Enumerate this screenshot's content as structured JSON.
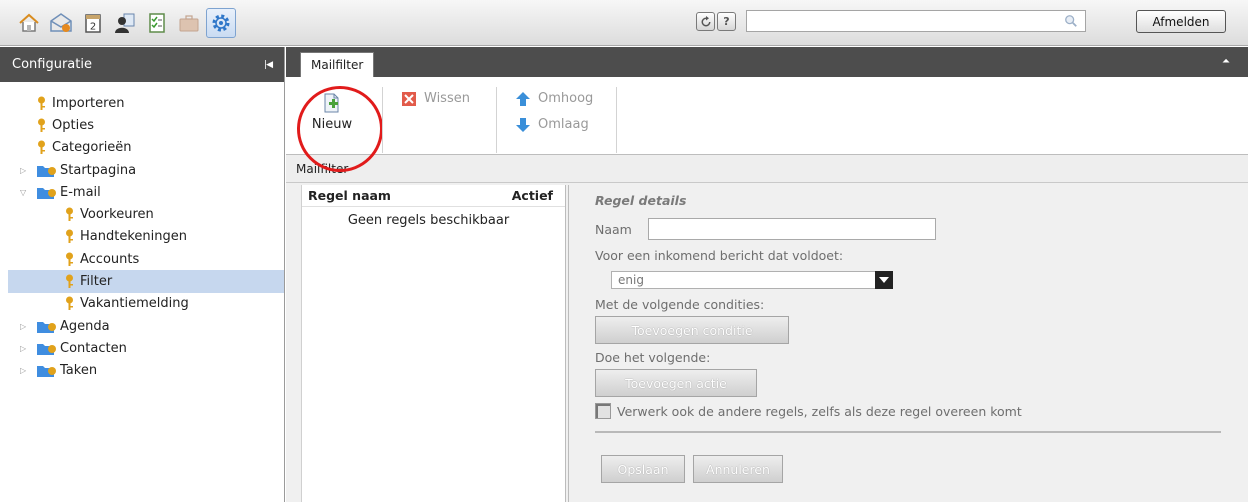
{
  "topbar": {
    "apps": [
      {
        "icon": "home-icon"
      },
      {
        "icon": "mail-icon"
      },
      {
        "icon": "calendar-icon",
        "text": "2"
      },
      {
        "icon": "contacts-icon"
      },
      {
        "icon": "tasks-icon"
      },
      {
        "icon": "briefcase-icon"
      },
      {
        "icon": "settings-gear-icon",
        "active": true
      }
    ],
    "refresh_icon": "refresh-icon",
    "help_label": "?",
    "search": {
      "value": "",
      "placeholder": ""
    },
    "logout_label": "Afmelden"
  },
  "sidebar": {
    "title": "Configuratie",
    "items": [
      {
        "label": "Importeren",
        "type": "key",
        "level": 0
      },
      {
        "label": "Opties",
        "type": "key",
        "level": 0
      },
      {
        "label": "Categorieën",
        "type": "key",
        "level": 0
      },
      {
        "label": "Startpagina",
        "type": "folder",
        "expanded": false
      },
      {
        "label": "E-mail",
        "type": "folder",
        "expanded": true
      },
      {
        "label": "Voorkeuren",
        "type": "key",
        "level": 1
      },
      {
        "label": "Handtekeningen",
        "type": "key",
        "level": 1
      },
      {
        "label": "Accounts",
        "type": "key",
        "level": 1
      },
      {
        "label": "Filter",
        "type": "key",
        "level": 1,
        "selected": true
      },
      {
        "label": "Vakantiemelding",
        "type": "key",
        "level": 1
      },
      {
        "label": "Agenda",
        "type": "folder",
        "expanded": false
      },
      {
        "label": "Contacten",
        "type": "folder",
        "expanded": false
      },
      {
        "label": "Taken",
        "type": "folder",
        "expanded": false
      }
    ]
  },
  "main": {
    "tab_label": "Mailfilter",
    "toolbar": {
      "new_label": "Nieuw",
      "delete_label": "Wissen",
      "up_label": "Omhoog",
      "down_label": "Omlaag"
    },
    "section_title": "Mailfilter",
    "rules": {
      "col_name": "Regel naam",
      "col_active": "Actief",
      "empty_text": "Geen regels beschikbaar"
    },
    "details": {
      "title": "Regel details",
      "name_label": "Naam",
      "name_value": "",
      "match_label": "Voor een inkomend bericht dat voldoet:",
      "match_value": "enig",
      "conditions_label": "Met de volgende condities:",
      "add_condition_label": "Toevoegen conditie",
      "actions_label": "Doe het volgende:",
      "add_action_label": "Toevoegen actie",
      "continue_label": "Verwerk ook de andere regels, zelfs als deze regel overeen komt",
      "save_label": "Opslaan",
      "cancel_label": "Annuleren"
    }
  },
  "colors": {
    "dark_header": "#4d4d4d",
    "selection": "#c6d7ee",
    "highlight_ring": "#e11b1b"
  }
}
